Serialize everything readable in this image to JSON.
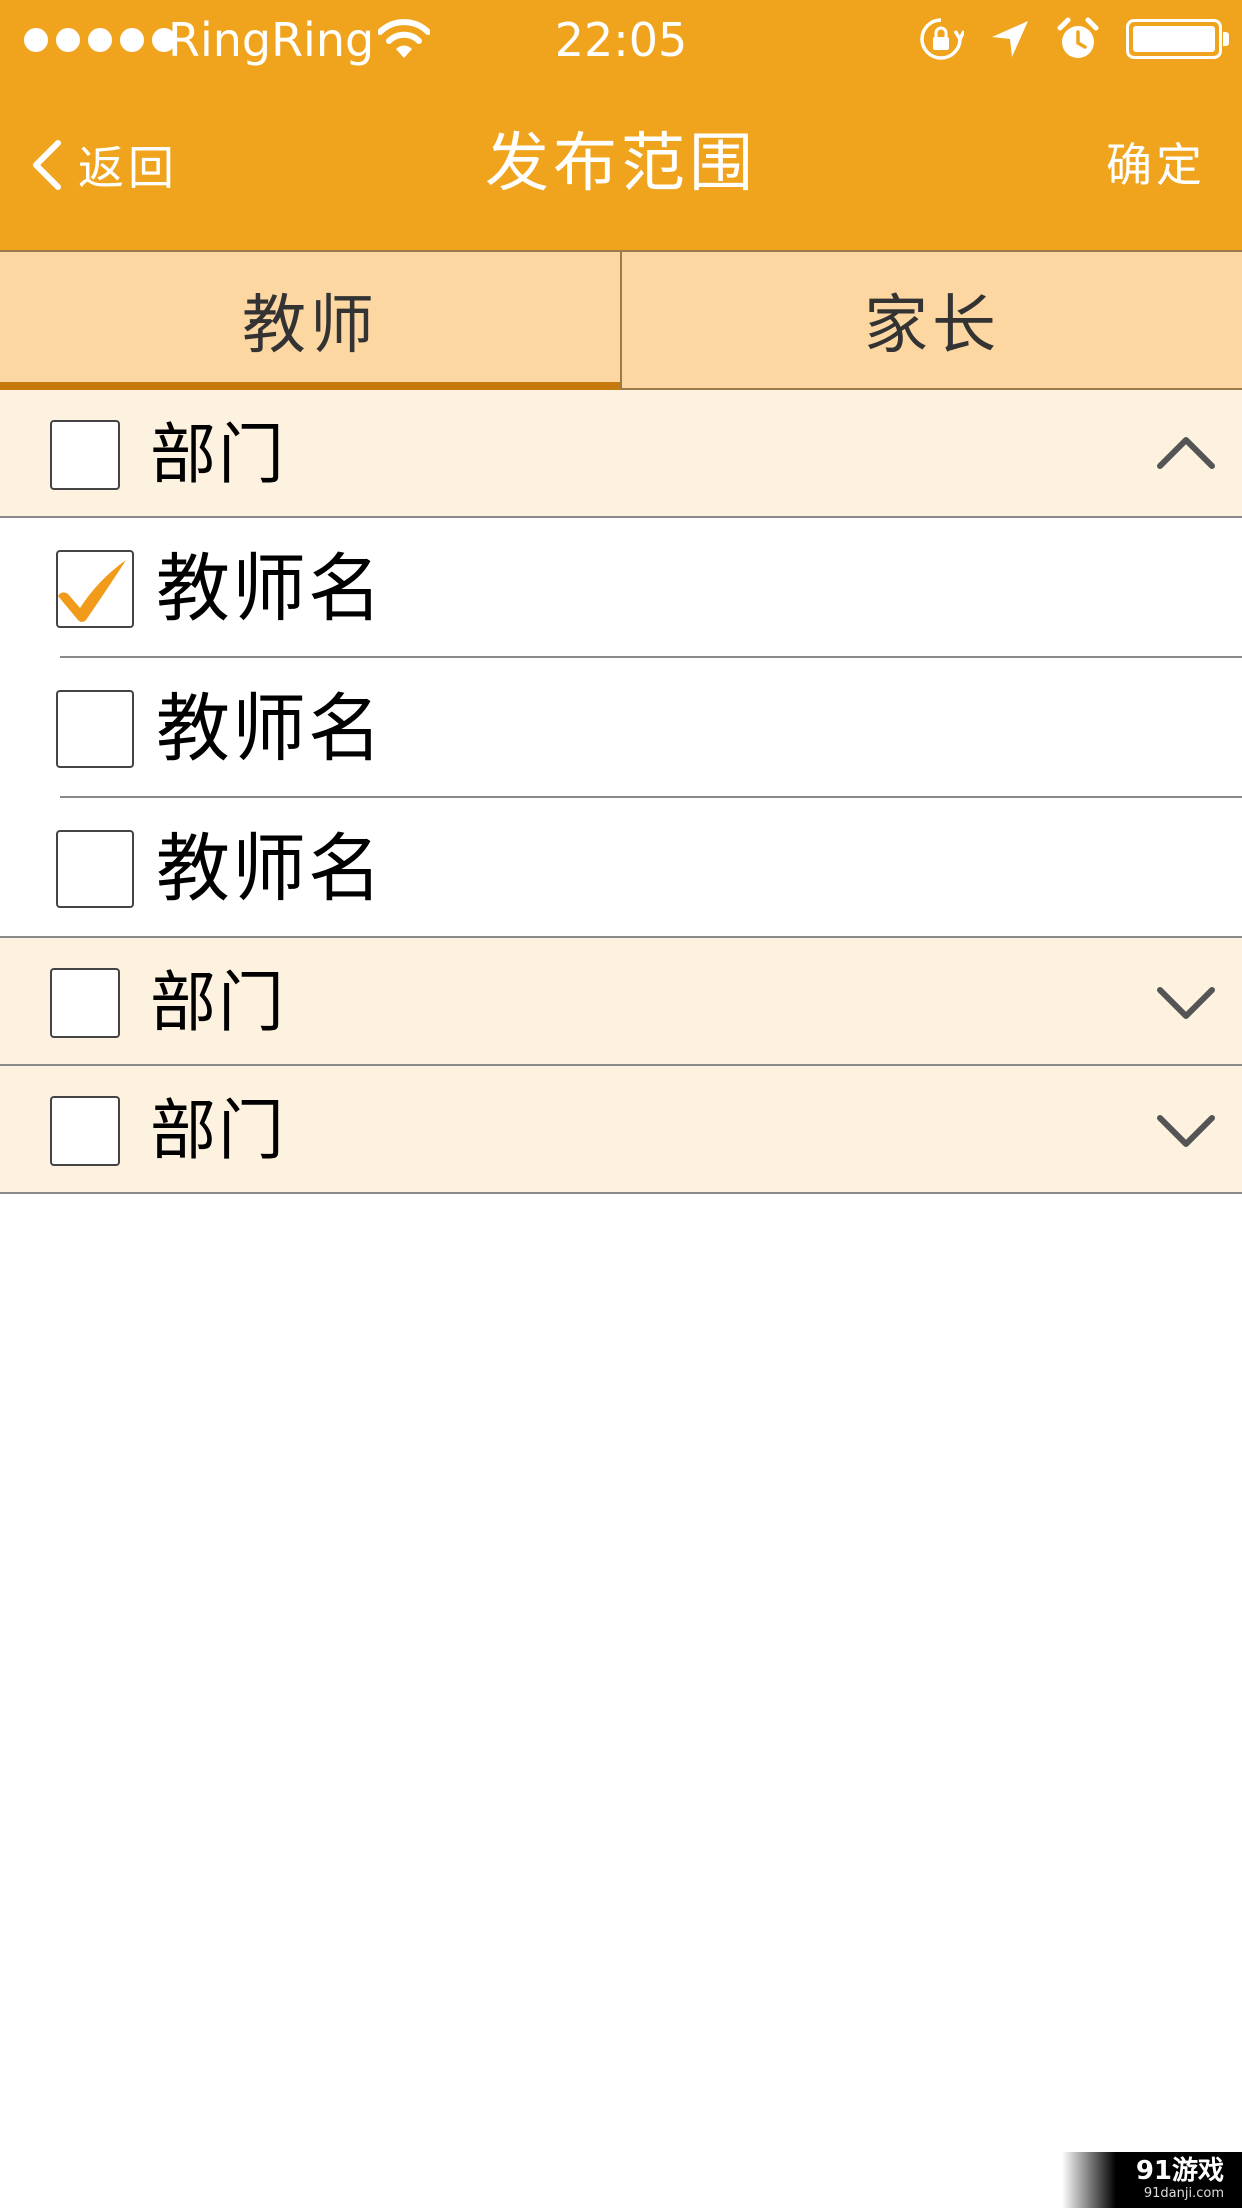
{
  "status_bar": {
    "carrier": "RingRing",
    "time": "22:05",
    "signal_dots": 5,
    "battery_level": 1.0,
    "icons": [
      "wifi-icon",
      "rotation-lock-icon",
      "location-arrow-icon",
      "alarm-icon",
      "battery-icon"
    ]
  },
  "nav": {
    "back_label": "返回",
    "title": "发布范围",
    "confirm_label": "确定"
  },
  "tabs": [
    {
      "label": "教师",
      "active": true
    },
    {
      "label": "家长",
      "active": false
    }
  ],
  "groups": [
    {
      "label": "部门",
      "checked": false,
      "expanded": true,
      "members": [
        {
          "label": "教师名",
          "checked": true
        },
        {
          "label": "教师名",
          "checked": false
        },
        {
          "label": "教师名",
          "checked": false
        }
      ]
    },
    {
      "label": "部门",
      "checked": false,
      "expanded": false,
      "members": []
    },
    {
      "label": "部门",
      "checked": false,
      "expanded": false,
      "members": []
    }
  ],
  "colors": {
    "header": "#F0A41E",
    "tab_bar": "#FDD7A2",
    "tab_indicator": "#C67A0B",
    "group_row": "#FDF2E0",
    "check_mark": "#F29A1A"
  },
  "watermark": {
    "main": "91游戏",
    "sub": "91danji.com"
  }
}
